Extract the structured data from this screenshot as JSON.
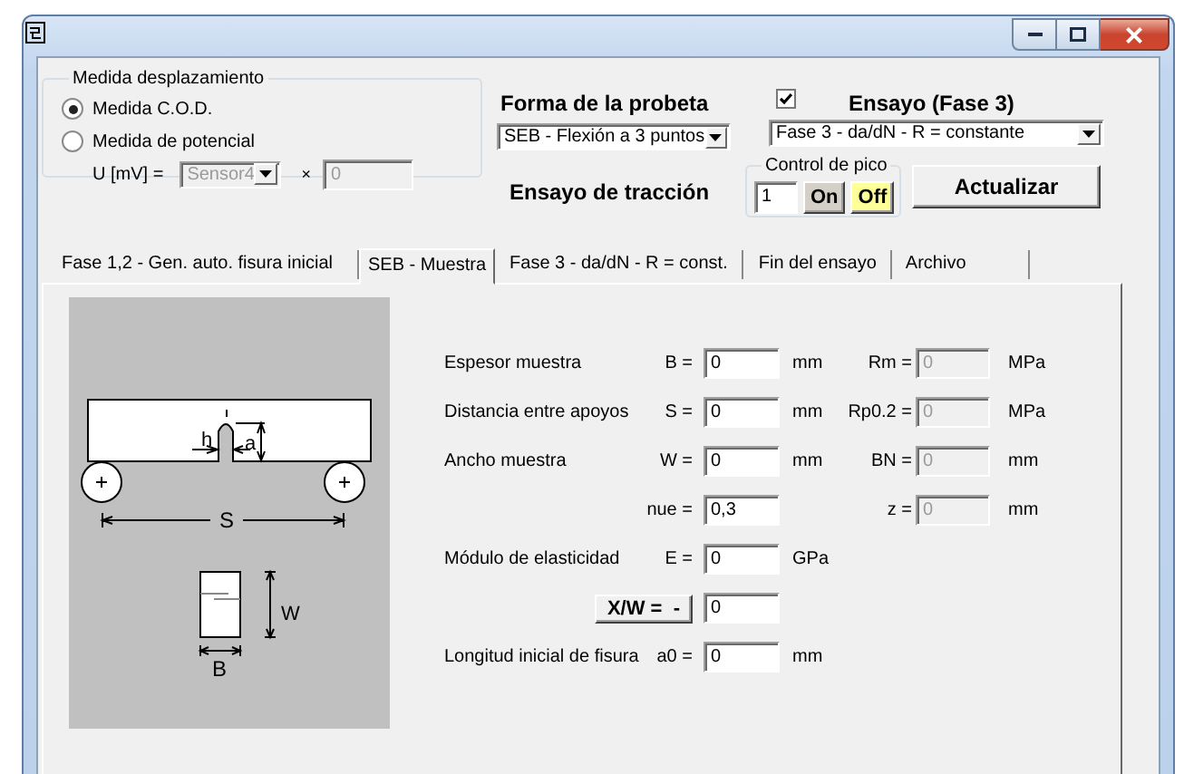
{
  "displacement": {
    "title": "Medida desplazamiento",
    "options": [
      {
        "label": "Medida C.O.D.",
        "selected": true
      },
      {
        "label": "Medida de potencial",
        "selected": false
      }
    ],
    "voltage": {
      "label": "U [mV] =",
      "sensor": "Sensor4",
      "multiplier": "×",
      "factor": "0",
      "disabled": true
    }
  },
  "specimen_shape": {
    "title": "Forma de la probeta",
    "value": "SEB - Flexión a 3 puntos"
  },
  "tensile_test": {
    "title": "Ensayo de tracción"
  },
  "test": {
    "checked": true,
    "title": "Ensayo (Fase 3)",
    "value": "Fase 3 - da/dN - R = constante"
  },
  "peak_control": {
    "title": "Control de pico",
    "value": "1",
    "buttons": [
      {
        "label": "On",
        "selected": false
      },
      {
        "label": "Off",
        "selected": true
      }
    ]
  },
  "update_button": {
    "label": "Actualizar"
  },
  "tabs": [
    {
      "label": "Fase 1,2 - Gen. auto. fisura inicial",
      "selected": false
    },
    {
      "label": "SEB - Muestra",
      "selected": true
    },
    {
      "label": "Fase 3 - da/dN - R = const.",
      "selected": false
    },
    {
      "label": "Fin del ensayo",
      "selected": false
    },
    {
      "label": "Archivo",
      "selected": false
    }
  ],
  "diagram": {
    "labels": [
      "h",
      "a",
      "S",
      "W",
      "B"
    ]
  },
  "fields": [
    {
      "kind": "field",
      "label": "Espesor muestra",
      "symbol": "B =",
      "value": "0",
      "unit": "mm"
    },
    {
      "kind": "field",
      "label": "Distancia entre apoyos",
      "symbol": "S =",
      "value": "0",
      "unit": "mm"
    },
    {
      "kind": "field",
      "label": "Ancho muestra",
      "symbol": "W =",
      "value": "0",
      "unit": "mm"
    },
    {
      "kind": "field",
      "symbol": "nue =",
      "value": "0,3"
    },
    {
      "kind": "field",
      "label": "Módulo de elasticidad",
      "symbol": "E =",
      "value": "0",
      "unit": "GPa"
    },
    {
      "kind": "button",
      "symbol": "X/W =  -",
      "value": "0"
    },
    {
      "kind": "field",
      "label": "Longitud inicial de fisura",
      "symbol": "a0 =",
      "value": "0",
      "unit": "mm"
    }
  ],
  "material": [
    {
      "symbol": "Rm =",
      "value": "0",
      "unit": "MPa",
      "disabled": true
    },
    {
      "symbol": "Rp0.2 =",
      "value": "0",
      "unit": "MPa",
      "disabled": true
    },
    {
      "symbol": "BN =",
      "value": "0",
      "unit": "mm",
      "disabled": true
    },
    {
      "symbol": "z =",
      "value": "0",
      "unit": "mm",
      "disabled": true
    }
  ]
}
